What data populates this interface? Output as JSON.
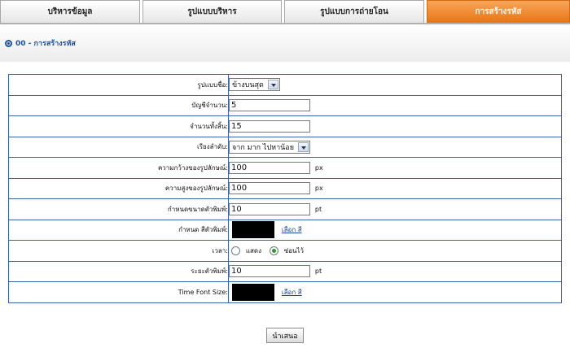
{
  "tabs": [
    {
      "label": "บริหารข้อมูล",
      "active": false
    },
    {
      "label": "รูปแบบบริหาร",
      "active": false
    },
    {
      "label": "รูปแบบการถ่ายโอน",
      "active": false
    },
    {
      "label": "การสร้างรหัส",
      "active": true
    }
  ],
  "breadcrumb": "00 - การสร้างรหัส",
  "form": {
    "name_format_label": "รูปแบบชื่อ:",
    "name_format_value": "ข้างบนสุด",
    "account_label": "บัญชีจำนวน:",
    "account_value": "5",
    "total_label": "จำนวนทั้งสิ้น:",
    "total_value": "15",
    "sort_label": "เรียงลำดับ:",
    "sort_value": "จาก มาก ไปหาน้อย",
    "width_label": "ความกว้างของรูปลักษณ์:",
    "width_value": "100",
    "width_unit": "px",
    "height_label": "ความสูงของรูปลักษณ์:",
    "height_value": "100",
    "height_unit": "px",
    "fontsize_label": "กำหนดขนาดตัวพิมพ์:",
    "fontsize_value": "10",
    "fontsize_unit": "pt",
    "color_label": "กำหนด สีตัวพิมพ์:",
    "color_value": "#000000",
    "color_link": "เลือก สี",
    "time_label": "เวลา:",
    "time_show": "แสดง",
    "time_hide": "ซ่อนไว้",
    "time_selected": "hide",
    "spacing_label": "ระยะตัวพิมพ์:",
    "spacing_value": "10",
    "spacing_unit": "pt",
    "time_font_label": "Time Font Size:",
    "time_font_color": "#000000",
    "time_font_link": "เลือก สี"
  },
  "submit_label": "นำเสนอ",
  "colors": {
    "tab_active": "#e87514",
    "border": "#3a62b0",
    "link": "#1a44a0"
  }
}
